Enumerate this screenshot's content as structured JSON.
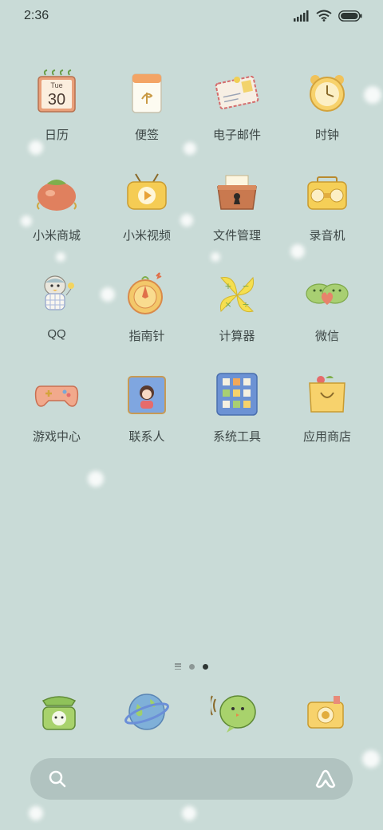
{
  "status": {
    "time": "2:36"
  },
  "apps": [
    {
      "label": "日历",
      "icon": "calendar-icon",
      "day": "Tue",
      "date": "30"
    },
    {
      "label": "便签",
      "icon": "notes-icon"
    },
    {
      "label": "电子邮件",
      "icon": "email-icon"
    },
    {
      "label": "时钟",
      "icon": "clock-icon"
    },
    {
      "label": "小米商城",
      "icon": "mi-store-icon"
    },
    {
      "label": "小米视频",
      "icon": "mi-video-icon"
    },
    {
      "label": "文件管理",
      "icon": "file-manager-icon"
    },
    {
      "label": "录音机",
      "icon": "recorder-icon"
    },
    {
      "label": "QQ",
      "icon": "qq-icon"
    },
    {
      "label": "指南针",
      "icon": "compass-icon"
    },
    {
      "label": "计算器",
      "icon": "calculator-icon"
    },
    {
      "label": "微信",
      "icon": "wechat-icon"
    },
    {
      "label": "游戏中心",
      "icon": "game-center-icon"
    },
    {
      "label": "联系人",
      "icon": "contacts-icon"
    },
    {
      "label": "系统工具",
      "icon": "system-tools-icon"
    },
    {
      "label": "应用商店",
      "icon": "app-store-icon"
    }
  ],
  "dock": [
    {
      "icon": "phone-icon"
    },
    {
      "icon": "browser-icon"
    },
    {
      "icon": "messages-icon"
    },
    {
      "icon": "camera-icon"
    }
  ],
  "colors": {
    "background": "#c9dbd7",
    "search_bar": "#b1c3c0"
  }
}
